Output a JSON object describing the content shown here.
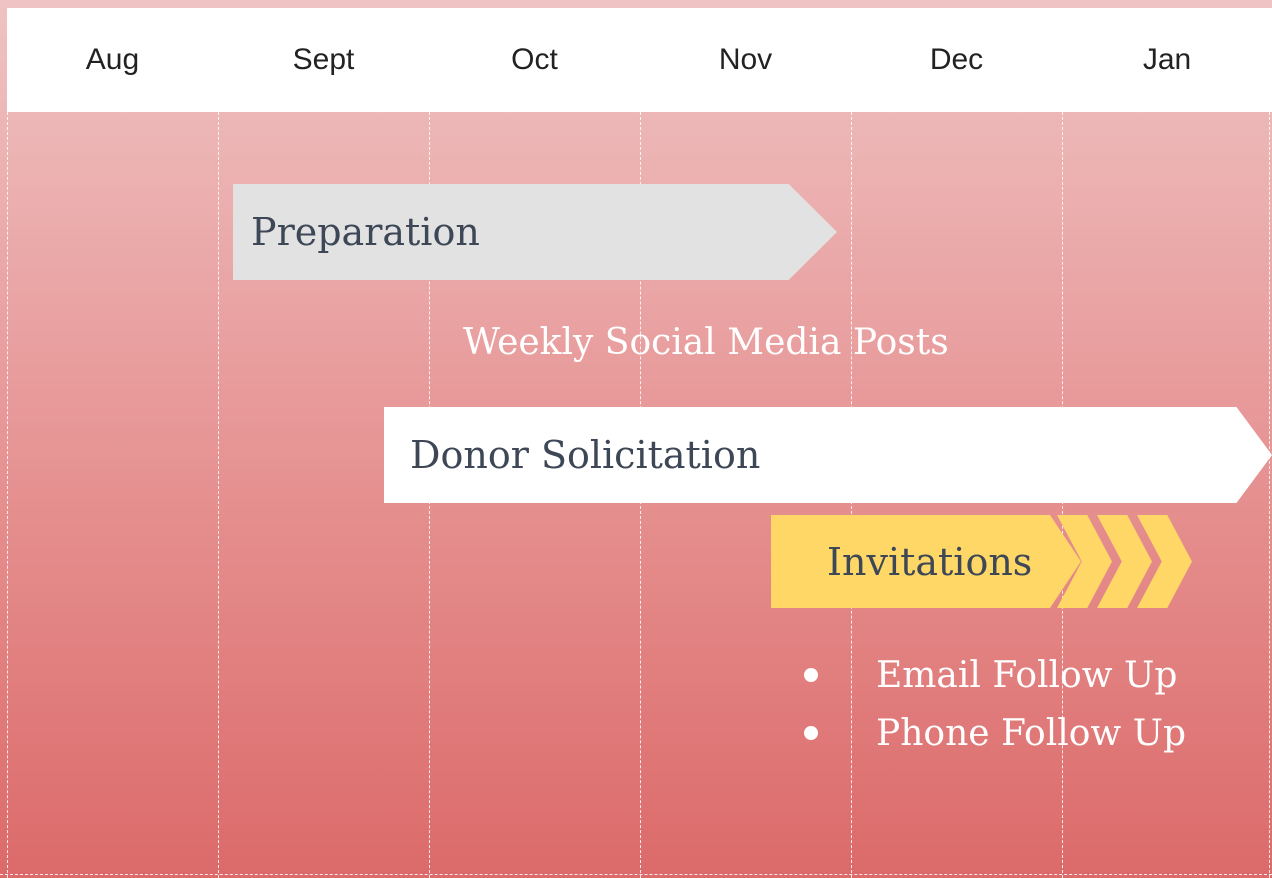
{
  "timeline": {
    "months": [
      "Aug",
      "Sept",
      "Oct",
      "Nov",
      "Dec",
      "Jan"
    ]
  },
  "tasks": {
    "preparation": "Preparation",
    "social_media": "Weekly Social Media Posts",
    "donor_solicitation": "Donor Solicitation",
    "invitations": "Invitations",
    "follow_ups": [
      "Email Follow Up",
      "Phone Follow Up"
    ]
  },
  "colors": {
    "background_top": "#efc3c3",
    "background_bottom": "#dc6a6a",
    "preparation_bar": "#e2e2e2",
    "donor_bar": "#ffffff",
    "invitations_bar": "#fed766",
    "bar_text": "#3d4756"
  }
}
